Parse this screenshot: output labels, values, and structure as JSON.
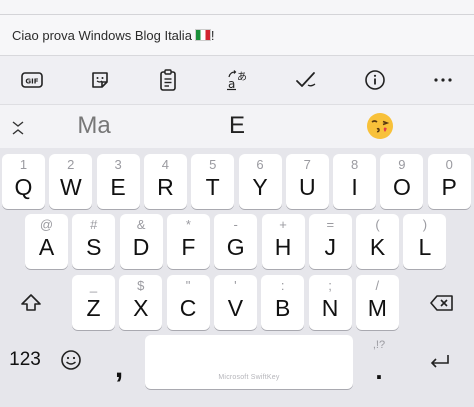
{
  "compose": {
    "text": "Ciao prova Windows Blog Italia",
    "flag_icon": "italy-flag-emoji"
  },
  "toolbar": {
    "gif_label": "GIF",
    "icons": [
      "gif-icon",
      "sticker-icon",
      "clipboard-icon",
      "translate-icon",
      "checkmark-icon",
      "info-icon",
      "more-icon"
    ]
  },
  "suggestions": {
    "left": "Ma",
    "center": "E",
    "emoji": "kiss-face-emoji"
  },
  "keyboard": {
    "row1": [
      {
        "main": "Q",
        "alt": "1"
      },
      {
        "main": "W",
        "alt": "2"
      },
      {
        "main": "E",
        "alt": "3"
      },
      {
        "main": "R",
        "alt": "4"
      },
      {
        "main": "T",
        "alt": "5"
      },
      {
        "main": "Y",
        "alt": "6"
      },
      {
        "main": "U",
        "alt": "7"
      },
      {
        "main": "I",
        "alt": "8"
      },
      {
        "main": "O",
        "alt": "9"
      },
      {
        "main": "P",
        "alt": "0"
      }
    ],
    "row2": [
      {
        "main": "A",
        "alt": "@"
      },
      {
        "main": "S",
        "alt": "#"
      },
      {
        "main": "D",
        "alt": "&"
      },
      {
        "main": "F",
        "alt": "*"
      },
      {
        "main": "G",
        "alt": "-"
      },
      {
        "main": "H",
        "alt": "+"
      },
      {
        "main": "J",
        "alt": "="
      },
      {
        "main": "K",
        "alt": "("
      },
      {
        "main": "L",
        "alt": ")"
      }
    ],
    "row3": [
      {
        "main": "Z",
        "alt": "_"
      },
      {
        "main": "X",
        "alt": "$"
      },
      {
        "main": "C",
        "alt": "\""
      },
      {
        "main": "V",
        "alt": "'"
      },
      {
        "main": "B",
        "alt": ":"
      },
      {
        "main": "N",
        "alt": ";"
      },
      {
        "main": "M",
        "alt": "/"
      }
    ],
    "numbers_label": "123",
    "comma": ",",
    "period": ".",
    "period_alt": ",!?",
    "space_brand": "Microsoft SwiftKey"
  }
}
